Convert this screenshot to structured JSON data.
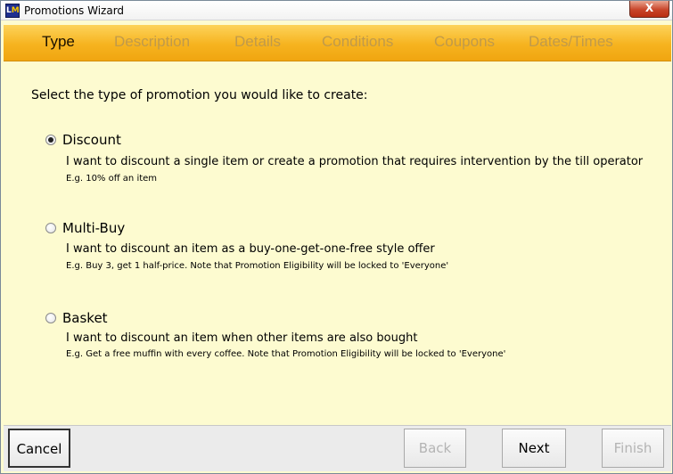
{
  "window": {
    "title": "Promotions Wizard",
    "close_label": "X"
  },
  "app_icon": {
    "name": "lm-logo",
    "text_l": "L",
    "text_m": "M"
  },
  "steps": [
    {
      "label": "Type",
      "active": true
    },
    {
      "label": "Description",
      "active": false
    },
    {
      "label": "Details",
      "active": false
    },
    {
      "label": "Conditions",
      "active": false
    },
    {
      "label": "Coupons",
      "active": false
    },
    {
      "label": "Dates/Times",
      "active": false
    }
  ],
  "prompt": "Select the type of promotion you would like to create:",
  "options": [
    {
      "title": "Discount",
      "selected": true,
      "description": "I want to discount a single item or create a promotion that requires intervention by the till operator",
      "example": "E.g. 10% off an item"
    },
    {
      "title": "Multi-Buy",
      "selected": false,
      "description": "I want to discount an item as a buy-one-get-one-free style offer",
      "example": "E.g. Buy 3, get 1 half-price.  Note that Promotion Eligibility will be locked to 'Everyone'"
    },
    {
      "title": "Basket",
      "selected": false,
      "description": "I want to discount an item when other items are also bought",
      "example": "E.g. Get a free muffin with every coffee.  Note that Promotion Eligibility will be locked to 'Everyone'"
    }
  ],
  "buttons": {
    "cancel": "Cancel",
    "back": "Back",
    "next": "Next",
    "finish": "Finish"
  },
  "colors": {
    "background": "#fdfbd0",
    "step_bar": "#f6b31f",
    "step_active": "#1a1000",
    "step_inactive": "#c09a4a"
  }
}
